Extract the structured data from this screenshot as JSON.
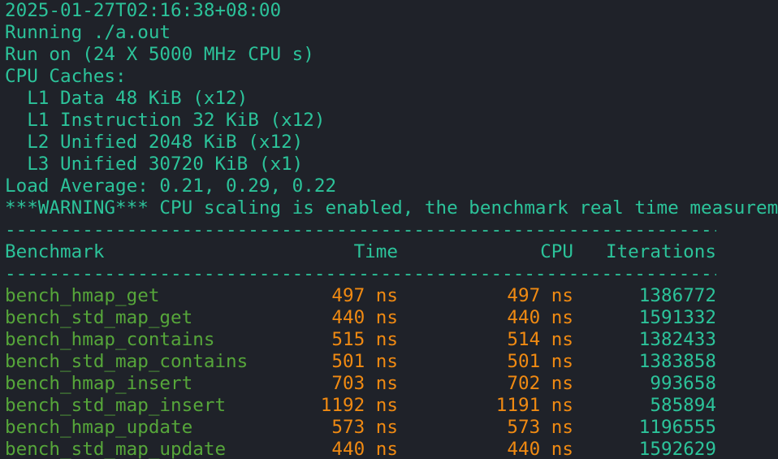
{
  "header_lines": [
    "2025-01-27T02:16:38+08:00",
    "Running ./a.out",
    "Run on (24 X 5000 MHz CPU s)",
    "CPU Caches:",
    "  L1 Data 48 KiB (x12)",
    "  L1 Instruction 32 KiB (x12)",
    "  L2 Unified 2048 KiB (x12)",
    "  L3 Unified 30720 KiB (x1)",
    "Load Average: 0.21, 0.29, 0.22",
    "***WARNING*** CPU scaling is enabled, the benchmark real time measurements may be noisy and will incur extra overhead."
  ],
  "separator": "----------------------------------------------------------------------------------------------------",
  "columns": {
    "benchmark": "Benchmark",
    "time": "Time",
    "cpu": "CPU",
    "iterations": "Iterations"
  },
  "rows": [
    {
      "name": "bench_hmap_get",
      "time": "497 ns",
      "cpu": "497 ns",
      "iterations": "1386772"
    },
    {
      "name": "bench_std_map_get",
      "time": "440 ns",
      "cpu": "440 ns",
      "iterations": "1591332"
    },
    {
      "name": "bench_hmap_contains",
      "time": "515 ns",
      "cpu": "514 ns",
      "iterations": "1382433"
    },
    {
      "name": "bench_std_map_contains",
      "time": "501 ns",
      "cpu": "501 ns",
      "iterations": "1383858"
    },
    {
      "name": "bench_hmap_insert",
      "time": "703 ns",
      "cpu": "702 ns",
      "iterations": "993658"
    },
    {
      "name": "bench_std_map_insert",
      "time": "1192 ns",
      "cpu": "1191 ns",
      "iterations": "585894"
    },
    {
      "name": "bench_hmap_update",
      "time": "573 ns",
      "cpu": "573 ns",
      "iterations": "1196555"
    },
    {
      "name": "bench_std_map_update",
      "time": "440 ns",
      "cpu": "440 ns",
      "iterations": "1592629"
    }
  ],
  "colors": {
    "background": "#1f2229",
    "teal": "#2cc39a",
    "green": "#56a63a",
    "orange": "#f08a12"
  }
}
